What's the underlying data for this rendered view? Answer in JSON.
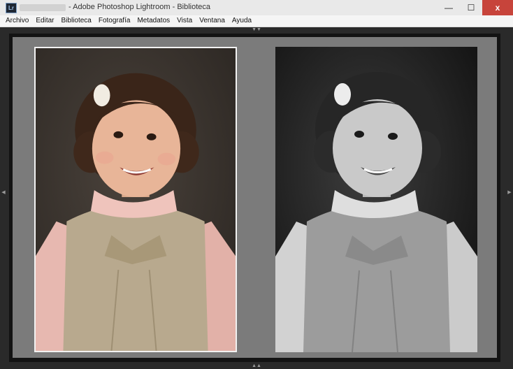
{
  "window": {
    "app_icon_text": "Lr",
    "title": "- Adobe Photoshop Lightroom - Biblioteca",
    "controls": {
      "minimize": "—",
      "maximize": "☐",
      "close": "x"
    }
  },
  "menubar": {
    "items": [
      {
        "label": "Archivo"
      },
      {
        "label": "Editar"
      },
      {
        "label": "Biblioteca"
      },
      {
        "label": "Fotografía"
      },
      {
        "label": "Metadatos"
      },
      {
        "label": "Vista"
      },
      {
        "label": "Ventana"
      },
      {
        "label": "Ayuda"
      }
    ]
  },
  "panel_grips": {
    "top": "▼▼",
    "bottom": "▲▲",
    "left": "◀",
    "right": "▶"
  },
  "compare": {
    "left_photo": {
      "name": "color-portrait",
      "colors": {
        "bg": "#332e2a",
        "sweater": "#b8a98e",
        "shirt": "#e8b5ad",
        "skin": "#e8b598",
        "hair": "#3a2519"
      }
    },
    "right_photo": {
      "name": "bw-portrait",
      "colors": {
        "bg": "#141414",
        "sweater": "#9c9c9c",
        "shirt": "#d6d6d6",
        "skin": "#c9c9c9",
        "hair": "#262626"
      }
    }
  }
}
